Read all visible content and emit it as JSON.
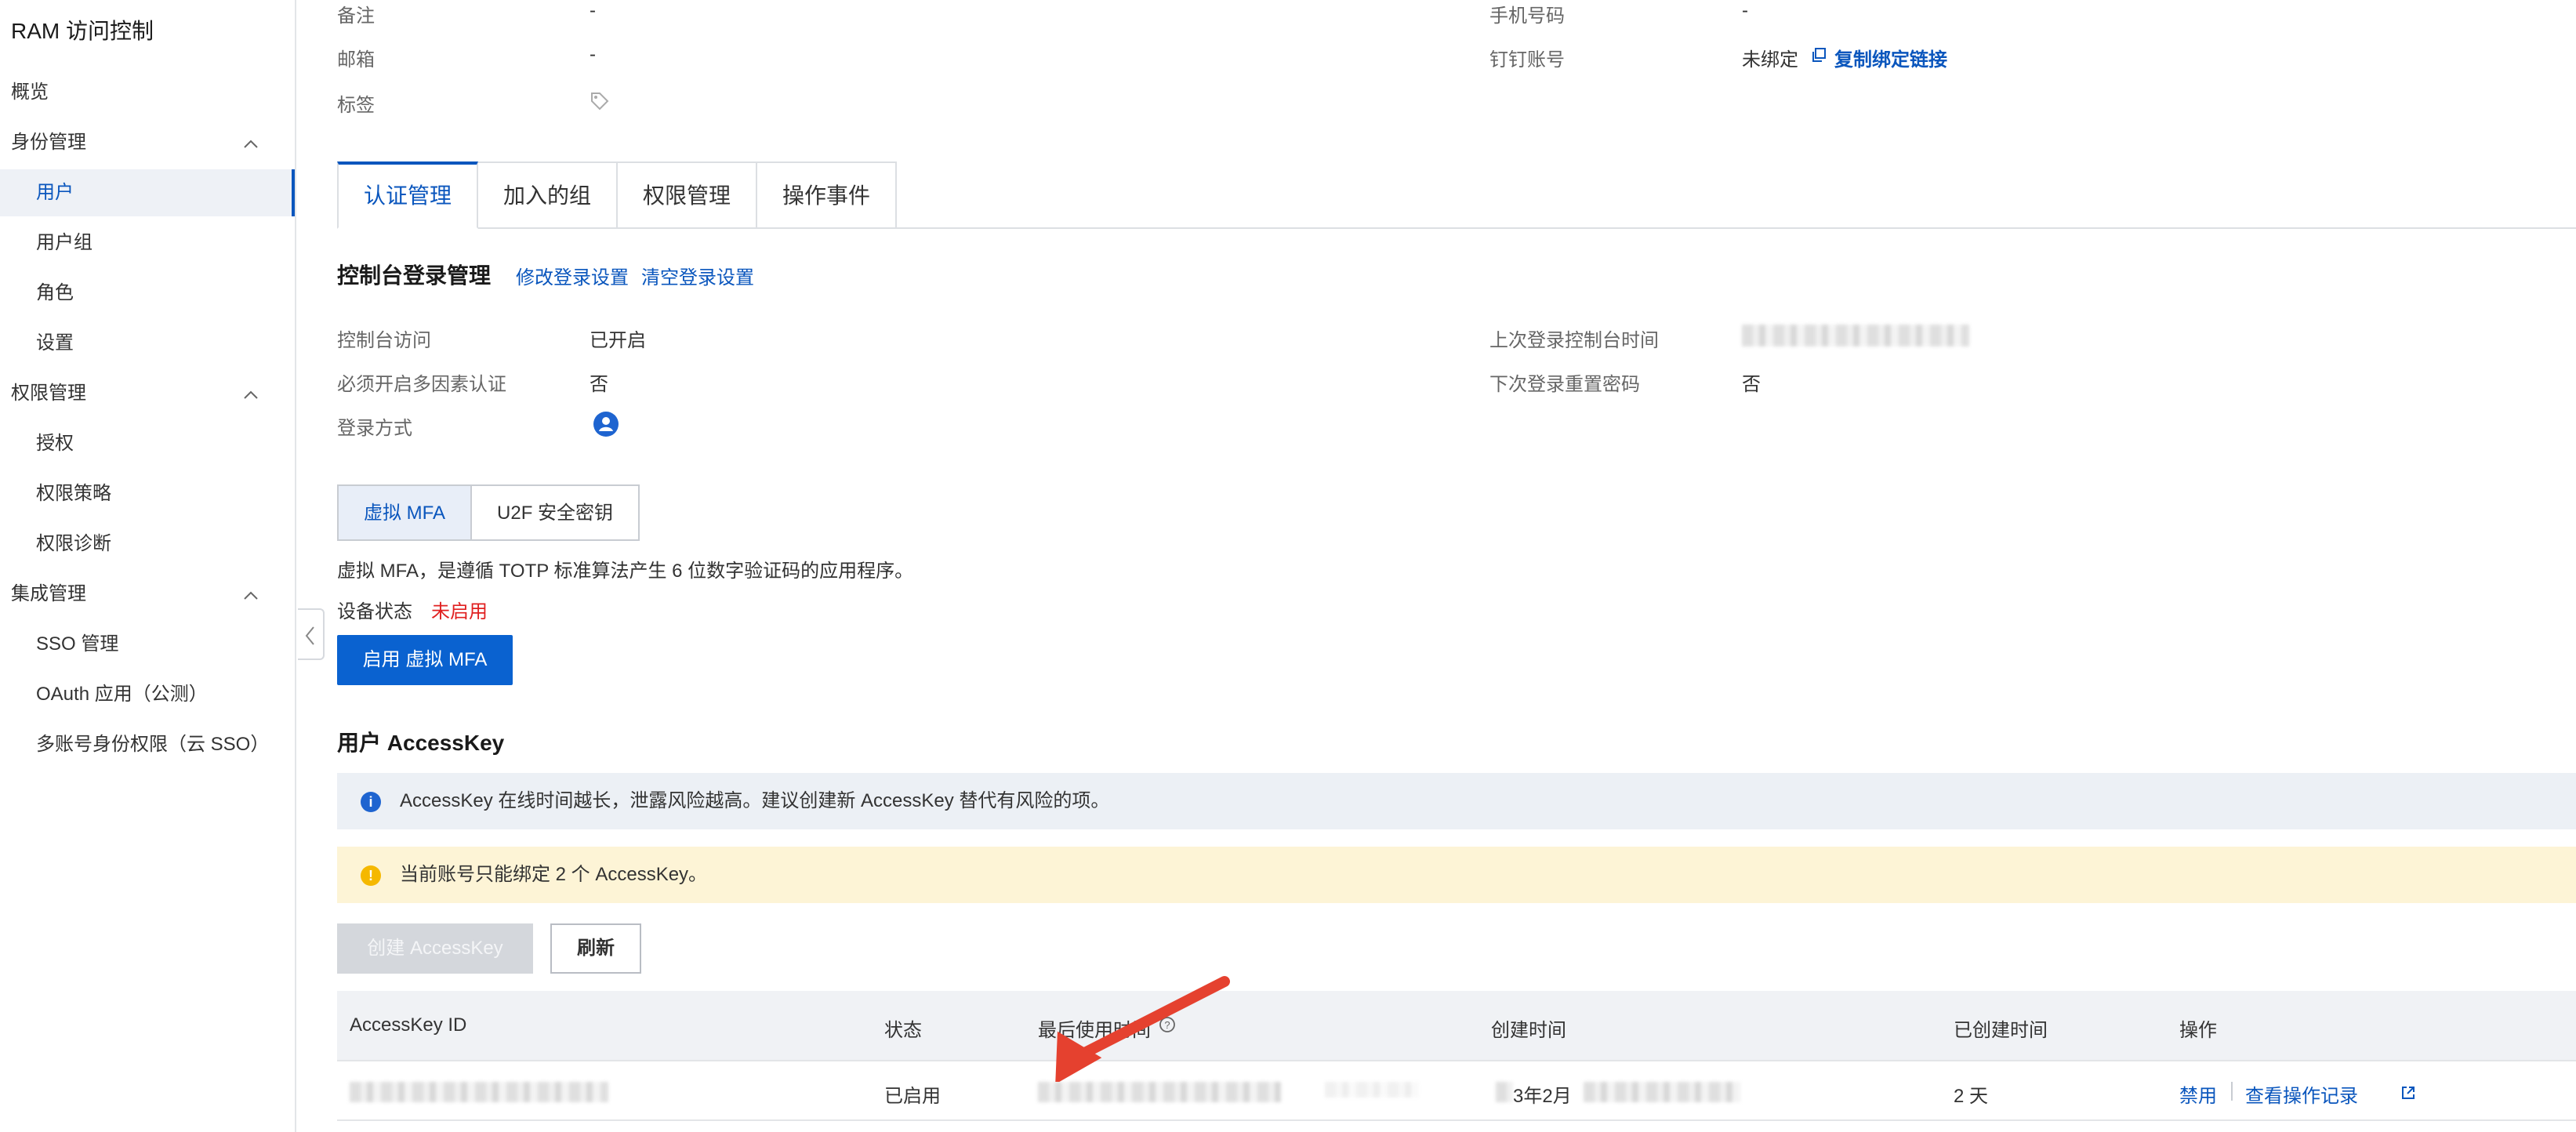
{
  "sidebar": {
    "title": "RAM 访问控制",
    "items": [
      {
        "label": "概览",
        "level": 1
      },
      {
        "label": "身份管理",
        "level": 1,
        "group": true
      },
      {
        "label": "用户",
        "level": 2,
        "active": true
      },
      {
        "label": "用户组",
        "level": 2
      },
      {
        "label": "角色",
        "level": 2
      },
      {
        "label": "设置",
        "level": 2
      },
      {
        "label": "权限管理",
        "level": 1,
        "group": true
      },
      {
        "label": "授权",
        "level": 2
      },
      {
        "label": "权限策略",
        "level": 2
      },
      {
        "label": "权限诊断",
        "level": 2
      },
      {
        "label": "集成管理",
        "level": 1,
        "group": true
      },
      {
        "label": "SSO 管理",
        "level": 2
      },
      {
        "label": "OAuth 应用（公测）",
        "level": 2
      },
      {
        "label": "多账号身份权限（云 SSO）",
        "level": 2
      }
    ]
  },
  "user_info": {
    "remark_label": "备注",
    "remark_value": "-",
    "email_label": "邮箱",
    "email_value": "-",
    "tags_label": "标签",
    "phone_label": "手机号码",
    "phone_value": "-",
    "dingtalk_label": "钉钉账号",
    "dingtalk_value": "未绑定",
    "copy_link_label": "复制绑定链接"
  },
  "tabs": [
    "认证管理",
    "加入的组",
    "权限管理",
    "操作事件"
  ],
  "console_login": {
    "title": "控制台登录管理",
    "edit_link": "修改登录设置",
    "clear_link": "清空登录设置",
    "access_label": "控制台访问",
    "access_value": "已开启",
    "mfa_required_label": "必须开启多因素认证",
    "mfa_required_value": "否",
    "login_method_label": "登录方式",
    "last_login_label": "上次登录控制台时间",
    "reset_pwd_label": "下次登录重置密码",
    "reset_pwd_value": "否"
  },
  "mfa": {
    "tabs": [
      "虚拟 MFA",
      "U2F 安全密钥"
    ],
    "description": "虚拟 MFA，是遵循 TOTP 标准算法产生 6 位数字验证码的应用程序。",
    "status_label": "设备状态",
    "status_value": "未启用",
    "enable_button": "启用 虚拟 MFA"
  },
  "accesskey": {
    "title": "用户 AccessKey",
    "info_alert": "AccessKey 在线时间越长，泄露风险越高。建议创建新 AccessKey 替代有风险的项。",
    "warn_alert": "当前账号只能绑定 2 个 AccessKey。",
    "create_button": "创建 AccessKey",
    "refresh_button": "刷新",
    "columns": [
      "AccessKey ID",
      "状态",
      "最后使用时间",
      "创建时间",
      "已创建时间",
      "操作"
    ],
    "rows": [
      {
        "status": "已启用",
        "created_partial": "3年2月",
        "age": "2 天",
        "action_disable": "禁用",
        "action_log": "查看操作记录"
      }
    ]
  },
  "colors": {
    "accent": "#0a56bd",
    "danger": "#e02020",
    "arrow": "#e5412f"
  }
}
